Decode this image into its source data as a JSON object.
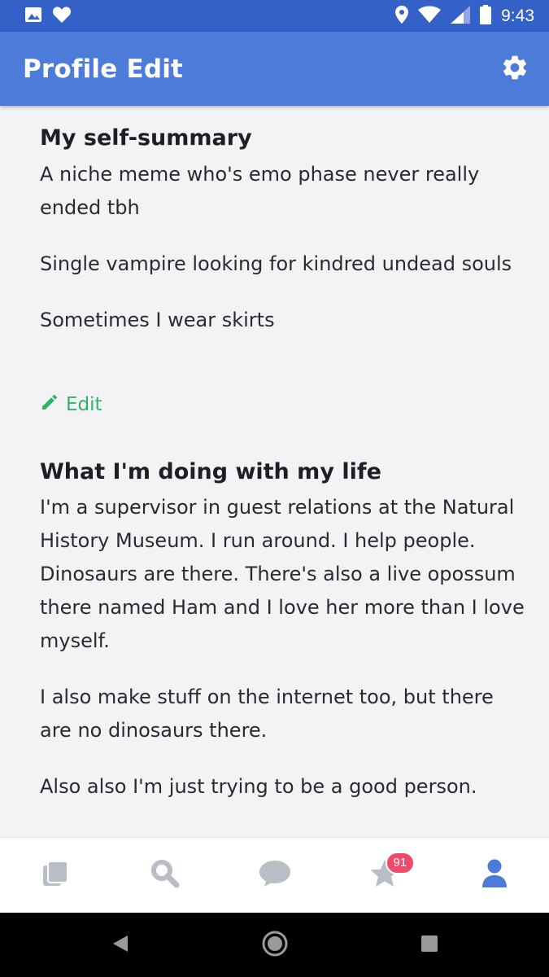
{
  "status_bar": {
    "time": "9:43",
    "left_icons": [
      "image-icon",
      "heart-icon"
    ],
    "right_icons": [
      "location-icon",
      "wifi-icon",
      "signal-icon",
      "battery-icon"
    ]
  },
  "app_bar": {
    "title": "Profile Edit",
    "settings_icon": "gear-icon"
  },
  "sections": [
    {
      "title": "My self-summary",
      "paragraphs": [
        "A niche meme who's emo phase never really ended tbh",
        "Single vampire looking for kindred undead souls",
        "Sometimes I wear skirts"
      ],
      "edit_label": "Edit"
    },
    {
      "title": "What I'm doing with my life",
      "paragraphs": [
        "I'm a supervisor in guest relations at the Natural History Museum. I run around. I help people. Dinosaurs are there. There's also a live opossum there named Ham and I love her more than I love myself.",
        "I also make stuff on the internet too, but there are no dinosaurs there.",
        "Also also I'm just trying to be a good person."
      ]
    }
  ],
  "bottom_nav": {
    "items": [
      "cards-icon",
      "search-icon",
      "chat-icon",
      "star-icon",
      "profile-icon"
    ],
    "star_badge": "91",
    "colors": {
      "inactive": "#b9bdc6",
      "active": "#4c7bd9",
      "badge": "#ee4a6b"
    }
  },
  "colors": {
    "status_bar": "#3361c8",
    "app_bar": "#4c7bd9",
    "edit_link": "#2eb36b",
    "background": "#f3f3f6"
  }
}
